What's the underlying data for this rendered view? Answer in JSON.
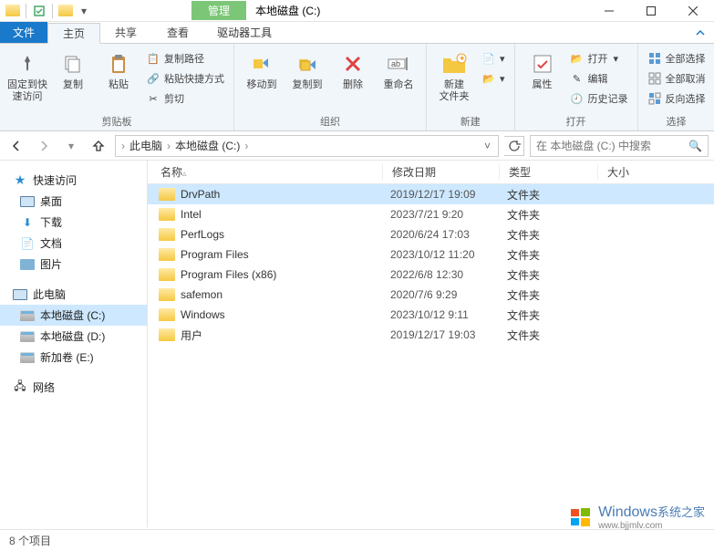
{
  "title": "本地磁盘 (C:)",
  "manage_label": "管理",
  "tabs": {
    "file": "文件",
    "home": "主页",
    "share": "共享",
    "view": "查看",
    "tools": "驱动器工具"
  },
  "ribbon": {
    "clipboard": {
      "label": "剪贴板",
      "pin": "固定到快\n速访问",
      "copy": "复制",
      "paste": "粘贴",
      "copy_path": "复制路径",
      "paste_shortcut": "粘贴快捷方式",
      "cut": "剪切"
    },
    "organize": {
      "label": "组织",
      "move_to": "移动到",
      "copy_to": "复制到",
      "delete": "删除",
      "rename": "重命名"
    },
    "new": {
      "label": "新建",
      "new_folder": "新建\n文件夹"
    },
    "open": {
      "label": "打开",
      "properties": "属性",
      "open": "打开",
      "edit": "编辑",
      "history": "历史记录"
    },
    "select": {
      "label": "选择",
      "select_all": "全部选择",
      "select_none": "全部取消",
      "invert": "反向选择"
    }
  },
  "breadcrumb": {
    "pc": "此电脑",
    "drive": "本地磁盘 (C:)"
  },
  "search_placeholder": "在 本地磁盘 (C:) 中搜索",
  "tree": {
    "quick_access": "快速访问",
    "desktop": "桌面",
    "downloads": "下载",
    "documents": "文档",
    "pictures": "图片",
    "this_pc": "此电脑",
    "drive_c": "本地磁盘 (C:)",
    "drive_d": "本地磁盘 (D:)",
    "drive_e": "新加卷 (E:)",
    "network": "网络"
  },
  "columns": {
    "name": "名称",
    "date": "修改日期",
    "type": "类型",
    "size": "大小"
  },
  "files": [
    {
      "name": "DrvPath",
      "date": "2019/12/17 19:09",
      "type": "文件夹"
    },
    {
      "name": "Intel",
      "date": "2023/7/21 9:20",
      "type": "文件夹"
    },
    {
      "name": "PerfLogs",
      "date": "2020/6/24 17:03",
      "type": "文件夹"
    },
    {
      "name": "Program Files",
      "date": "2023/10/12 11:20",
      "type": "文件夹"
    },
    {
      "name": "Program Files (x86)",
      "date": "2022/6/8 12:30",
      "type": "文件夹"
    },
    {
      "name": "safemon",
      "date": "2020/7/6 9:29",
      "type": "文件夹"
    },
    {
      "name": "Windows",
      "date": "2023/10/12 9:11",
      "type": "文件夹"
    },
    {
      "name": "用户",
      "date": "2019/12/17 19:03",
      "type": "文件夹"
    }
  ],
  "status": "8 个项目",
  "watermark": {
    "brand": "Windows",
    "sub": "系统之家",
    "url": "www.bjjmlv.com"
  }
}
